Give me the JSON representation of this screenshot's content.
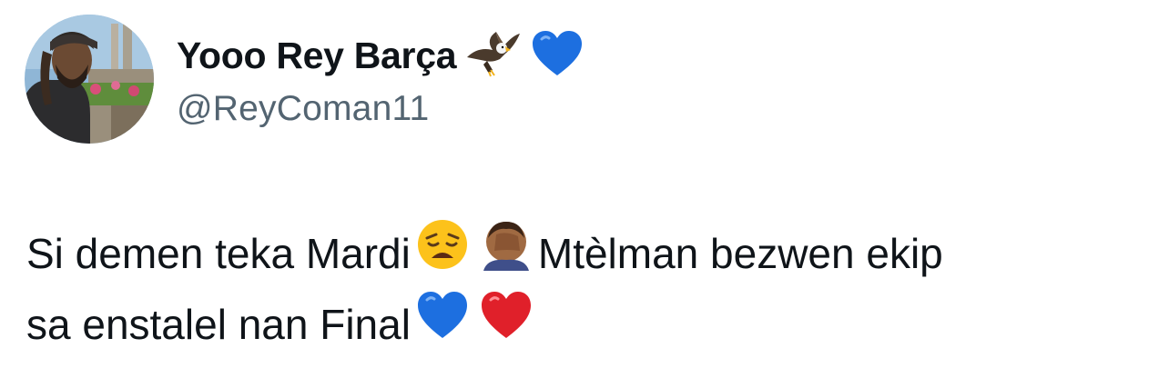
{
  "author": {
    "display_name": "Yooo Rey Barça",
    "handle": "@ReyComan11",
    "name_emojis": [
      "eagle-icon",
      "blue-heart-icon"
    ]
  },
  "tweet": {
    "line1_text1": "Si demen teka Mardi",
    "line1_text2": "Mtèlman bezwen ekip",
    "line2_text1": "sa enstalel nan Final",
    "emojis": [
      "weary-face-icon",
      "facepalm-icon",
      "blue-heart-icon",
      "red-heart-icon"
    ]
  },
  "colors": {
    "text": "#0f1419",
    "handle": "#536471",
    "blue_heart": "#1d6fe0",
    "red_heart": "#e0202a"
  }
}
